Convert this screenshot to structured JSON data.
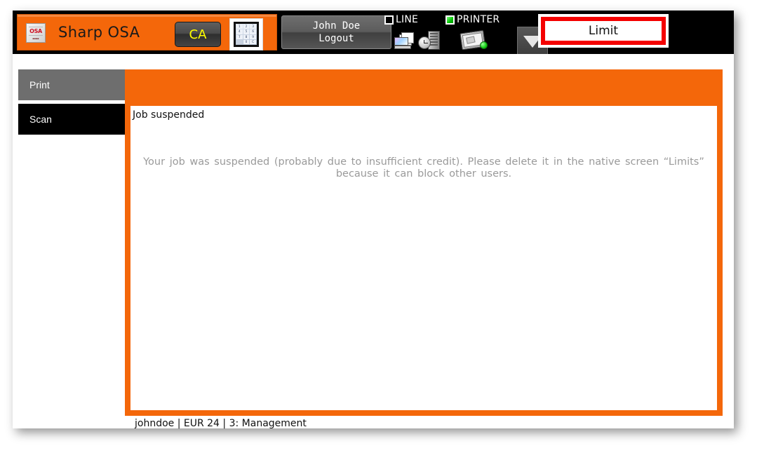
{
  "app": {
    "brand": "Sharp OSA",
    "logo_text": "OSA",
    "logo_sub": "Sharp Open Systems Architecture"
  },
  "toolbar": {
    "ca_label": "CA",
    "keypad_keys": [
      "1",
      "2",
      "3",
      "4",
      "5",
      "6",
      "7",
      "8",
      "9",
      "",
      "0",
      "C"
    ],
    "user_name": "John Doe",
    "logout_label": "Logout",
    "dropdown_icon": "triangle-down-icon",
    "limit_label": "Limit",
    "limit_border_color": "#f40000"
  },
  "status": {
    "line": {
      "label": "LINE",
      "led": "off",
      "led_color": "#000000"
    },
    "printer": {
      "label": "PRINTER",
      "led": "on",
      "led_color": "#05c405"
    }
  },
  "sidebar": {
    "items": [
      {
        "label": "Print",
        "state": "inactive"
      },
      {
        "label": "Scan",
        "state": "active"
      }
    ]
  },
  "content": {
    "title": "Job suspended",
    "message": "Your job was suspended (probably due to insufficient credit). Please delete it in the native screen “Limits” because it can block other users.",
    "frame_color": "#f4670a"
  },
  "statusbar": {
    "text": "johndoe | EUR 24 | 3: Management"
  }
}
